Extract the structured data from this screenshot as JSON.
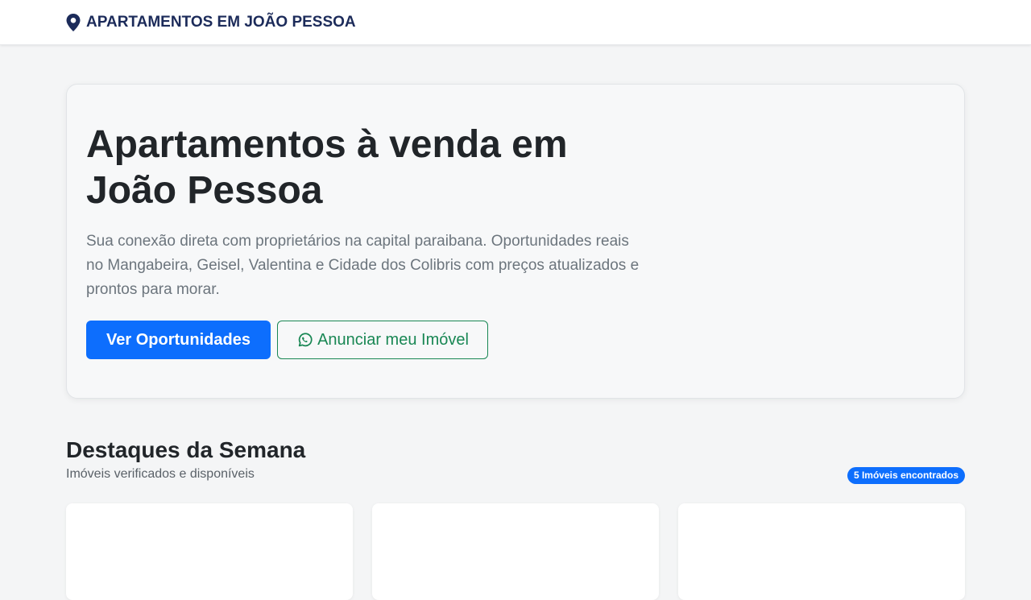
{
  "navbar": {
    "brand_icon": "map-pin-icon",
    "brand_text": "APARTAMENTOS EM JOÃO PESSOA"
  },
  "hero": {
    "title": "Apartamentos à venda em João Pessoa",
    "description": "Sua conexão direta com proprietários na capital paraibana. Oportunidades reais no Mangabeira, Geisel, Valentina e Cidade dos Colibris com preços atualizados e prontos para morar.",
    "primary_button": "Ver Oportunidades",
    "secondary_button": "Anunciar meu Imóvel",
    "secondary_icon": "whatsapp-icon"
  },
  "highlights": {
    "title": "Destaques da Semana",
    "subtitle": "Imóveis verificados e disponíveis",
    "badge": "5 Imóveis encontrados"
  },
  "colors": {
    "primary": "#0d6efd",
    "success": "#198754",
    "brand": "#1c2b5a",
    "text_dark": "#212529",
    "text_muted": "#6c757d",
    "background": "#f4f5f6"
  }
}
